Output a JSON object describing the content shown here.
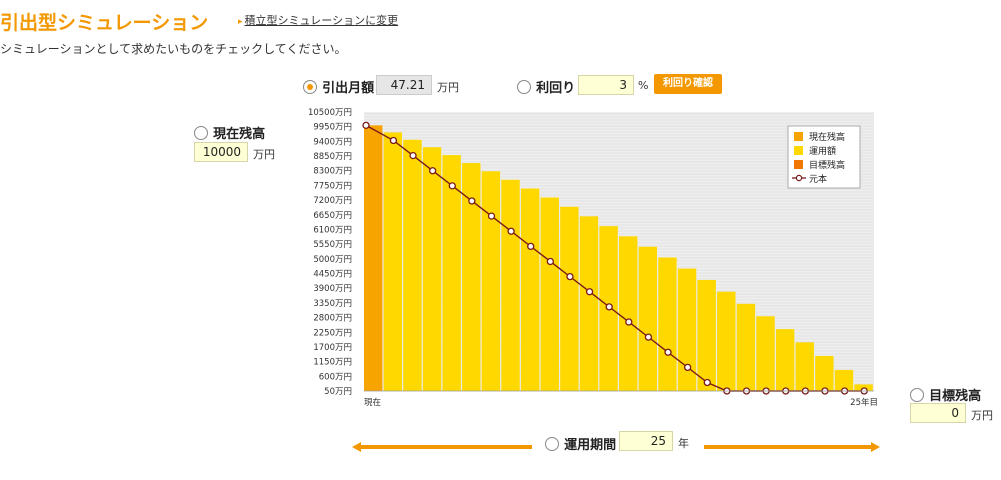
{
  "header": {
    "title": "引出型シミュレーション",
    "switch_link": "積立型シミュレーションに変更",
    "subtitle": "シミュレーションとして求めたいものをチェックしてください。"
  },
  "withdrawal": {
    "label": "引出月額",
    "value": "47.21",
    "unit": "万円",
    "selected": true
  },
  "yield": {
    "label": "利回り",
    "value": "3",
    "unit": "%",
    "button": "利回り確認"
  },
  "current_balance": {
    "label": "現在残高",
    "value": "10000",
    "unit": "万円"
  },
  "target_balance": {
    "label": "目標残高",
    "value": "0",
    "unit": "万円"
  },
  "period": {
    "label": "運用期間",
    "value": "25",
    "unit": "年"
  },
  "colors": {
    "accent": "#f39800",
    "bar_current": "#f7a300",
    "bar_running": "#ffd800",
    "line": "#7a1a1a"
  },
  "chart_data": {
    "type": "bar",
    "yticks": [
      "10500万円",
      "9950万円",
      "9400万円",
      "8850万円",
      "8300万円",
      "7750万円",
      "7200万円",
      "6650万円",
      "6100万円",
      "5550万円",
      "5000万円",
      "4450万円",
      "3900万円",
      "3350万円",
      "2800万円",
      "2250万円",
      "1700万円",
      "1150万円",
      "600万円",
      "50万円"
    ],
    "ylim": [
      50,
      10500
    ],
    "x_start_label": "現在",
    "x_end_label": "25年目",
    "legend": [
      "現在残高",
      "運用額",
      "目標残高",
      "元本"
    ],
    "legend_position": "top-right",
    "series": [
      {
        "name": "運用額",
        "values": [
          10000,
          9734,
          9460,
          9178,
          8887,
          8588,
          8279,
          7961,
          7634,
          7297,
          6950,
          6592,
          6224,
          5844,
          5453,
          5051,
          4636,
          4209,
          3769,
          3316,
          2849,
          2368,
          1873,
          1363,
          838,
          297
        ]
      },
      {
        "name": "元本",
        "values": [
          10000,
          9433,
          8867,
          8300,
          7734,
          7167,
          6601,
          6034,
          5467,
          4901,
          4334,
          3768,
          3201,
          2635,
          2068,
          1501,
          935,
          368,
          0,
          0,
          0,
          0,
          0,
          0,
          0,
          0
        ]
      }
    ]
  }
}
